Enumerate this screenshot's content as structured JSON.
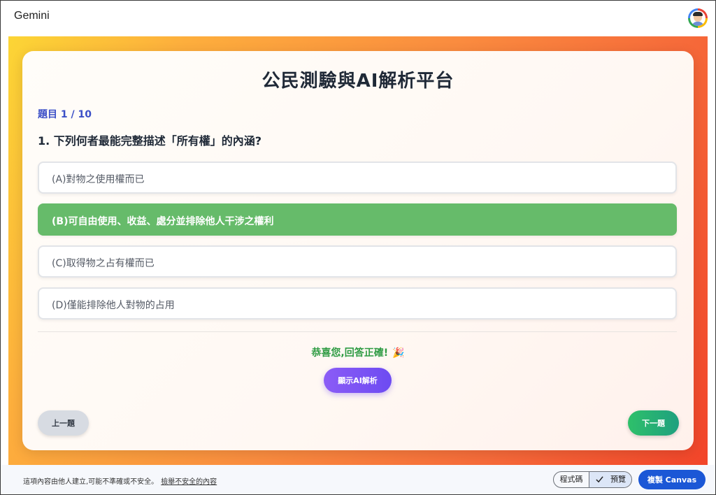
{
  "app": {
    "brand": "Gemini"
  },
  "quiz": {
    "title": "公民測驗與AI解析平台",
    "counter": "題目 1 / 10",
    "question": "1. 下列何者最能完整描述「所有權」的內涵?",
    "options": [
      {
        "label": "(A)對物之使用權而已",
        "state": "default"
      },
      {
        "label": "(B)可自由使用、收益、處分並排除他人干涉之權利",
        "state": "correct"
      },
      {
        "label": "(C)取得物之占有權而已",
        "state": "default"
      },
      {
        "label": "(D)僅能排除他人對物的占用",
        "state": "default"
      }
    ],
    "feedback": "恭喜您,回答正確!",
    "feedback_icon": "🎉",
    "ai_button": "顯示AI解析",
    "prev_button": "上一題",
    "next_button": "下一題"
  },
  "footer": {
    "disclaimer": "這項內容由他人建立,可能不準確或不安全。",
    "report_link": "檢舉不安全的內容",
    "code_label": "程式碼",
    "preview_label": "預覽",
    "copy_button": "複製 Canvas"
  },
  "colors": {
    "correct": "#66bb6a",
    "accent": "#3b4fc7",
    "feedback": "#2e9b43",
    "copy_button": "#1b57d6"
  }
}
